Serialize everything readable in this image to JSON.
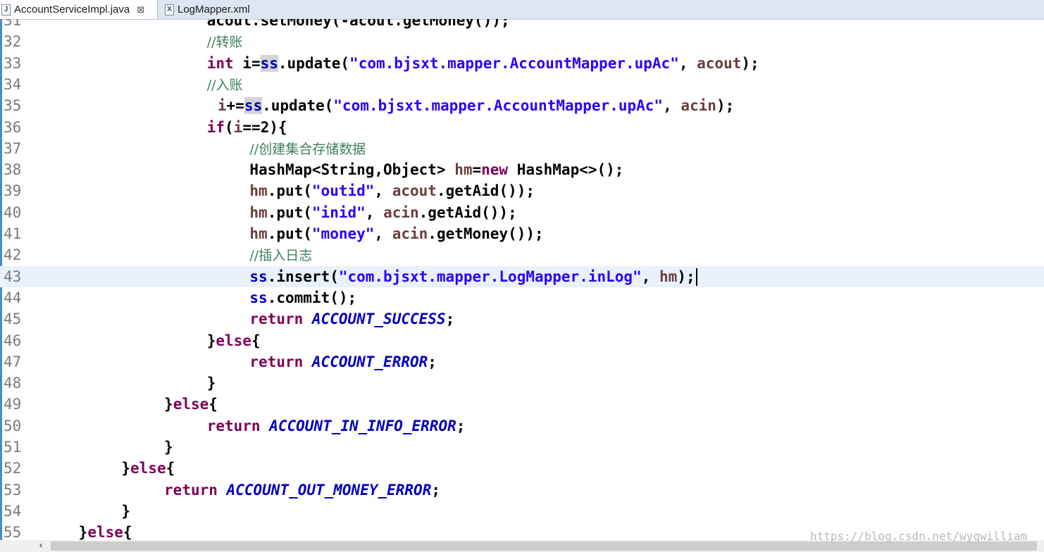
{
  "tabs": [
    {
      "label": "AccountServiceImpl.java",
      "icon": "java-file-icon",
      "active": true,
      "close": "⊠"
    },
    {
      "label": "LogMapper.xml",
      "icon": "xml-file-icon",
      "active": false
    }
  ],
  "editor": {
    "current_line": 43,
    "lines": [
      {
        "n": "31",
        "indent": 16,
        "tokens": [
          {
            "t": "acout.setMoney(-acout.getMoney());"
          }
        ]
      },
      {
        "n": "32",
        "indent": 16,
        "tokens": [
          {
            "t": "//转账",
            "c": "cm"
          }
        ]
      },
      {
        "n": "33",
        "indent": 16,
        "tokens": [
          {
            "t": "int",
            "c": "kw"
          },
          {
            "t": " i="
          },
          {
            "t": "ss",
            "c": "fld hl"
          },
          {
            "t": ".update("
          },
          {
            "t": "\"com.bjsxt.mapper.AccountMapper.upAc\"",
            "c": "str"
          },
          {
            "t": ", "
          },
          {
            "t": "acout",
            "c": "var"
          },
          {
            "t": ");"
          }
        ]
      },
      {
        "n": "34",
        "indent": 16,
        "tokens": [
          {
            "t": "//入账",
            "c": "cm"
          }
        ]
      },
      {
        "n": "35",
        "indent": 17,
        "tokens": [
          {
            "t": "i",
            "c": "var"
          },
          {
            "t": "+="
          },
          {
            "t": "ss",
            "c": "fld hl"
          },
          {
            "t": ".update("
          },
          {
            "t": "\"com.bjsxt.mapper.AccountMapper.upAc\"",
            "c": "str"
          },
          {
            "t": ", "
          },
          {
            "t": "acin",
            "c": "var"
          },
          {
            "t": ");"
          }
        ]
      },
      {
        "n": "36",
        "indent": 16,
        "tokens": [
          {
            "t": "if",
            "c": "kw"
          },
          {
            "t": "("
          },
          {
            "t": "i",
            "c": "var"
          },
          {
            "t": "==2){"
          }
        ]
      },
      {
        "n": "37",
        "indent": 20,
        "tokens": [
          {
            "t": "//创建集合存储数据",
            "c": "cm"
          }
        ]
      },
      {
        "n": "38",
        "indent": 20,
        "tokens": [
          {
            "t": "HashMap<String,Object> "
          },
          {
            "t": "hm",
            "c": "var"
          },
          {
            "t": "="
          },
          {
            "t": "new",
            "c": "kw"
          },
          {
            "t": " HashMap<>();"
          }
        ]
      },
      {
        "n": "39",
        "indent": 20,
        "tokens": [
          {
            "t": "hm",
            "c": "var"
          },
          {
            "t": ".put("
          },
          {
            "t": "\"outid\"",
            "c": "str"
          },
          {
            "t": ", "
          },
          {
            "t": "acout",
            "c": "var"
          },
          {
            "t": ".getAid());"
          }
        ]
      },
      {
        "n": "40",
        "indent": 20,
        "tokens": [
          {
            "t": "hm",
            "c": "var"
          },
          {
            "t": ".put("
          },
          {
            "t": "\"inid\"",
            "c": "str"
          },
          {
            "t": ", "
          },
          {
            "t": "acin",
            "c": "var"
          },
          {
            "t": ".getAid());"
          }
        ]
      },
      {
        "n": "41",
        "indent": 20,
        "tokens": [
          {
            "t": "hm",
            "c": "var"
          },
          {
            "t": ".put("
          },
          {
            "t": "\"money\"",
            "c": "str"
          },
          {
            "t": ", "
          },
          {
            "t": "acin",
            "c": "var"
          },
          {
            "t": ".getMoney());"
          }
        ]
      },
      {
        "n": "42",
        "indent": 20,
        "tokens": [
          {
            "t": "//插入日志",
            "c": "cm"
          }
        ]
      },
      {
        "n": "43",
        "indent": 20,
        "tokens": [
          {
            "t": "ss",
            "c": "fld"
          },
          {
            "t": ".insert("
          },
          {
            "t": "\"com.bjsxt.mapper.LogMapper.inLog\"",
            "c": "str"
          },
          {
            "t": ", "
          },
          {
            "t": "hm",
            "c": "var"
          },
          {
            "t": ");"
          }
        ]
      },
      {
        "n": "44",
        "indent": 20,
        "tokens": [
          {
            "t": "ss",
            "c": "fld"
          },
          {
            "t": ".commit();"
          }
        ]
      },
      {
        "n": "45",
        "indent": 20,
        "tokens": [
          {
            "t": "return",
            "c": "kw"
          },
          {
            "t": " "
          },
          {
            "t": "ACCOUNT_SUCCESS",
            "c": "cst"
          },
          {
            "t": ";"
          }
        ]
      },
      {
        "n": "46",
        "indent": 16,
        "tokens": [
          {
            "t": "}"
          },
          {
            "t": "else",
            "c": "kw"
          },
          {
            "t": "{"
          }
        ]
      },
      {
        "n": "47",
        "indent": 20,
        "tokens": [
          {
            "t": "return",
            "c": "kw"
          },
          {
            "t": " "
          },
          {
            "t": "ACCOUNT_ERROR",
            "c": "cst"
          },
          {
            "t": ";"
          }
        ]
      },
      {
        "n": "48",
        "indent": 16,
        "tokens": [
          {
            "t": "}"
          }
        ]
      },
      {
        "n": "49",
        "indent": 12,
        "tokens": [
          {
            "t": "}"
          },
          {
            "t": "else",
            "c": "kw"
          },
          {
            "t": "{"
          }
        ]
      },
      {
        "n": "50",
        "indent": 16,
        "tokens": [
          {
            "t": "return",
            "c": "kw"
          },
          {
            "t": " "
          },
          {
            "t": "ACCOUNT_IN_INFO_ERROR",
            "c": "cst"
          },
          {
            "t": ";"
          }
        ]
      },
      {
        "n": "51",
        "indent": 12,
        "tokens": [
          {
            "t": "}"
          }
        ]
      },
      {
        "n": "52",
        "indent": 8,
        "tokens": [
          {
            "t": "}"
          },
          {
            "t": "else",
            "c": "kw"
          },
          {
            "t": "{"
          }
        ]
      },
      {
        "n": "53",
        "indent": 12,
        "tokens": [
          {
            "t": "return",
            "c": "kw"
          },
          {
            "t": " "
          },
          {
            "t": "ACCOUNT_OUT_MONEY_ERROR",
            "c": "cst"
          },
          {
            "t": ";"
          }
        ]
      },
      {
        "n": "54",
        "indent": 8,
        "tokens": [
          {
            "t": "}"
          }
        ]
      },
      {
        "n": "55",
        "indent": 4,
        "tokens": [
          {
            "t": "}"
          },
          {
            "t": "else",
            "c": "kw"
          },
          {
            "t": "{"
          }
        ]
      }
    ]
  },
  "scrollbar": {
    "left_arrow": "‹"
  },
  "watermark": "https://blog.csdn.net/wyqwilliam"
}
